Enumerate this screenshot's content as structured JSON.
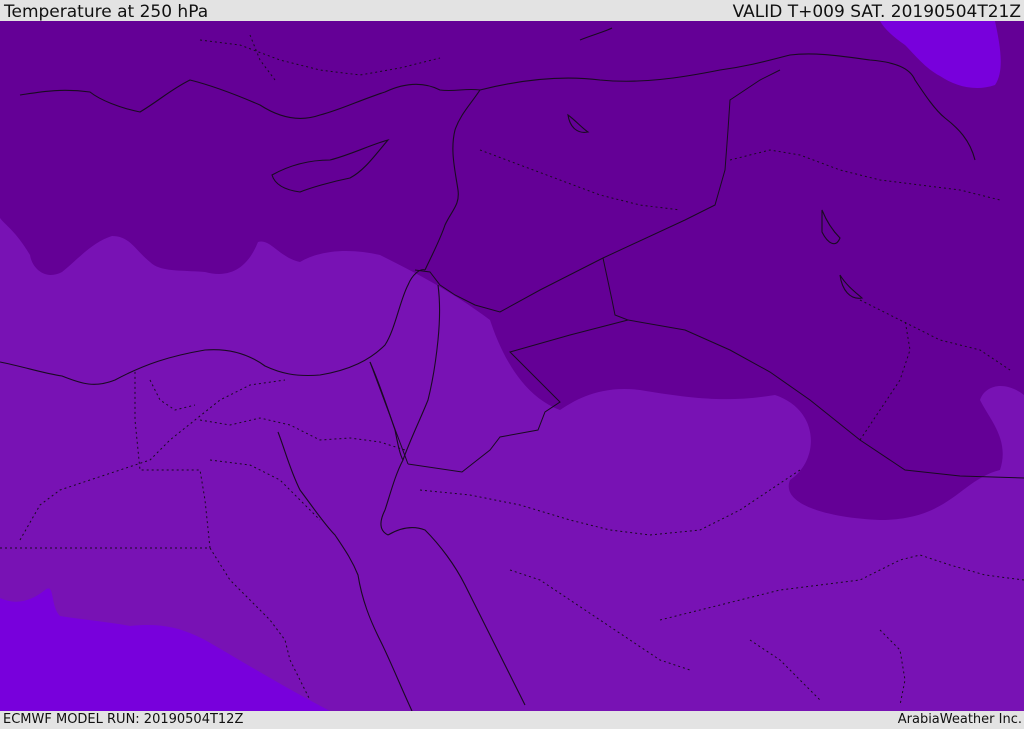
{
  "header": {
    "title": "Temperature at 250 hPa",
    "valid_time": "VALID T+009 SAT. 20190504T21Z"
  },
  "footer": {
    "model_run": "ECMWF MODEL RUN: 20190504T12Z",
    "credit": "ArabiaWeather Inc."
  },
  "map": {
    "field": "temperature",
    "pressure_level_hpa": 250,
    "shading_colors": {
      "coldest_band": "#640096",
      "middle_band": "#7812b4",
      "warmest_band": "#7800dc"
    },
    "coastline_color": "#1a0a22",
    "border_style": "dotted",
    "legend": "none",
    "graticule": "none"
  }
}
